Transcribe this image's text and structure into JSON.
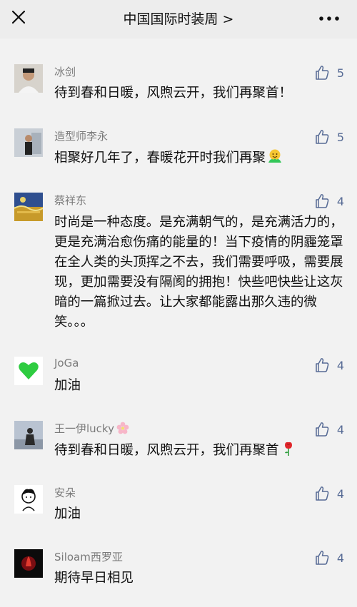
{
  "header": {
    "title": "中国国际时装周 >",
    "close_icon": "close-icon",
    "more_icon": "more-icon"
  },
  "colors": {
    "background": "#f2f2f2",
    "name": "#7a7a7a",
    "text": "#111111",
    "like": "#576b95"
  },
  "comments": [
    {
      "name": "冰剑",
      "text": "待到春和日暖，风煦云开，我们再聚首！",
      "likes": "5"
    },
    {
      "name": "造型师李永",
      "text": "相聚好几年了，春暖花开时我们再聚",
      "emoji": "hugging-face-emoji",
      "likes": "5"
    },
    {
      "name": "蔡祥东",
      "text": "时尚是一种态度。是充满朝气的，是充满活力的，更是充满治愈伤痛的能量的！当下疫情的阴霾笼罩在全人类的头顶挥之不去，我们需要呼吸，需要展现，更加需要没有隔阂的拥抱！快些吧快些让这灰暗的一篇掀过去。让大家都能露出那久违的微笑。。。",
      "likes": "4"
    },
    {
      "name": "JoGa",
      "text": "加油",
      "likes": "4"
    },
    {
      "name": "王一伊lucky",
      "name_emoji": "cherry-blossom-emoji",
      "text": "待到春和日暖，风煦云开，我们再聚首",
      "emoji": "rose-emoji",
      "likes": "4"
    },
    {
      "name": "安朵",
      "text": "加油",
      "likes": "4"
    },
    {
      "name": "Siloam西罗亚",
      "text": "期待早日相见",
      "likes": "4"
    }
  ]
}
